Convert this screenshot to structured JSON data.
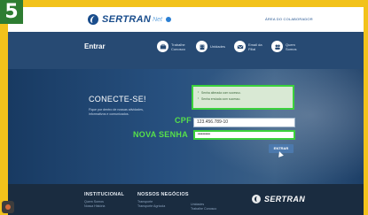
{
  "step": "5",
  "header": {
    "logo_text": "SERTRAN",
    "logo_sub": "Net",
    "top_link": "ÁREA DO COLABORADOR"
  },
  "nav": {
    "title": "Entrar",
    "items": [
      {
        "label": "Trabalhe Conosco",
        "icon": "briefcase-icon"
      },
      {
        "label": "Unidades",
        "icon": "building-icon"
      },
      {
        "label": "Email da Filial",
        "icon": "mail-icon"
      },
      {
        "label": "Quem Somos",
        "icon": "people-icon"
      }
    ]
  },
  "main": {
    "title": "CONECTE-SE!",
    "text": "Fique por dentro de nossas atividades, informativos e comunicados.",
    "messages": [
      "Senha alterada com sucesso.",
      "Senha enviada com sucesso."
    ],
    "cpf_label": "CPF",
    "cpf_value": "123.456.789-10",
    "password_label": "NOVA SENHA",
    "password_value": "••••••••",
    "enter_button": "ENTRAR"
  },
  "footer": {
    "col1_title": "INSTITUCIONAL",
    "col1_links": [
      "Quem Somos",
      "Nossa História"
    ],
    "col2_title": "NOSSOS NEGÓCIOS",
    "col2_links": [
      "Transporte",
      "Transporte Agrícola"
    ],
    "col3_links": [
      "Unidades",
      "Trabalhe Conosco"
    ],
    "logo_text": "SERTRAN"
  },
  "colors": {
    "frame": "#f2c21b",
    "highlight": "#3bd13b",
    "brand": "#1a4d8c"
  }
}
